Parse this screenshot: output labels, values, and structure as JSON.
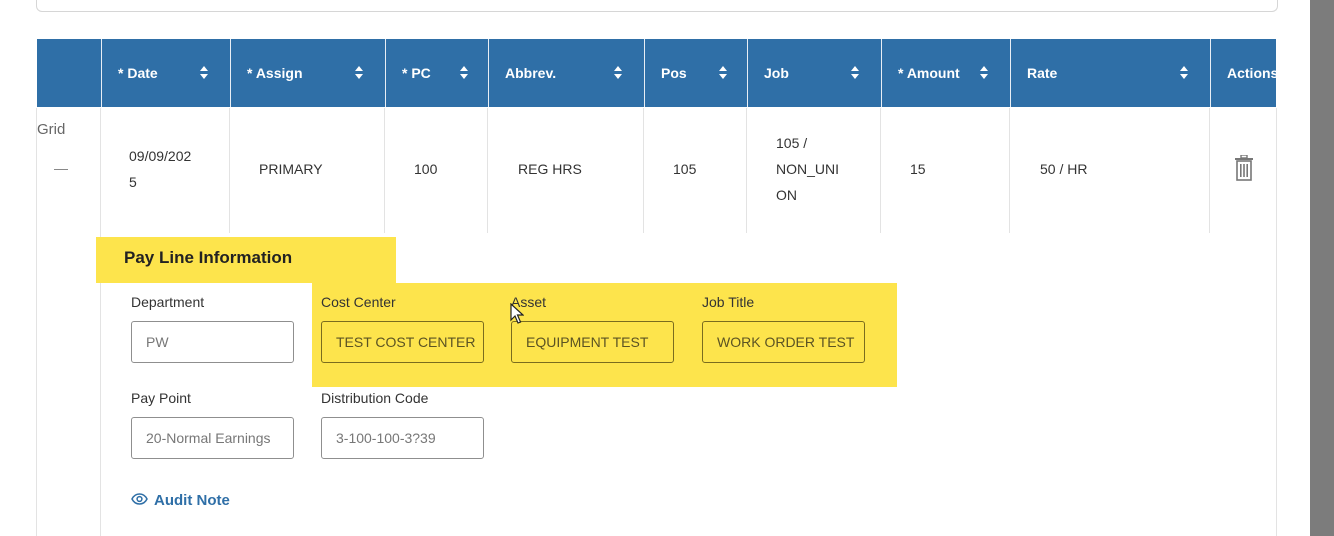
{
  "table": {
    "headers": [
      {
        "label": "",
        "sortable": false
      },
      {
        "label": "* Date",
        "sortable": true
      },
      {
        "label": "* Assign",
        "sortable": true
      },
      {
        "label": "* PC",
        "sortable": true
      },
      {
        "label": "Abbrev.",
        "sortable": true
      },
      {
        "label": "Pos",
        "sortable": true
      },
      {
        "label": "Job",
        "sortable": true
      },
      {
        "label": "* Amount",
        "sortable": true
      },
      {
        "label": "Rate",
        "sortable": true
      },
      {
        "label": "Actions",
        "sortable": false
      }
    ],
    "row": {
      "grid_label": "Grid",
      "date_line1": "09/09/202",
      "date_line2": "5",
      "assign": "PRIMARY",
      "pc": "100",
      "abbrev": "REG HRS",
      "pos": "105",
      "job_line1": "105 /",
      "job_line2": "NON_UNI",
      "job_line3": "ON",
      "amount": "15",
      "rate": "50 / HR"
    }
  },
  "pay_line": {
    "title": "Pay Line Information",
    "fields": {
      "department": {
        "label": "Department",
        "value": "PW"
      },
      "cost_center": {
        "label": "Cost Center",
        "value": "TEST COST CENTER"
      },
      "asset": {
        "label": "Asset",
        "value": "EQUIPMENT TEST"
      },
      "job_title": {
        "label": "Job Title",
        "value": "WORK ORDER TEST"
      },
      "pay_point": {
        "label": "Pay Point",
        "value": "20-Normal Earnings"
      },
      "distribution_code": {
        "label": "Distribution Code",
        "value": "3-100-100-3?39"
      }
    },
    "audit_note_label": "Audit Note"
  },
  "colors": {
    "header_bg": "#2f6fa7",
    "highlight": "#fde44c",
    "link": "#2f6fa7"
  }
}
